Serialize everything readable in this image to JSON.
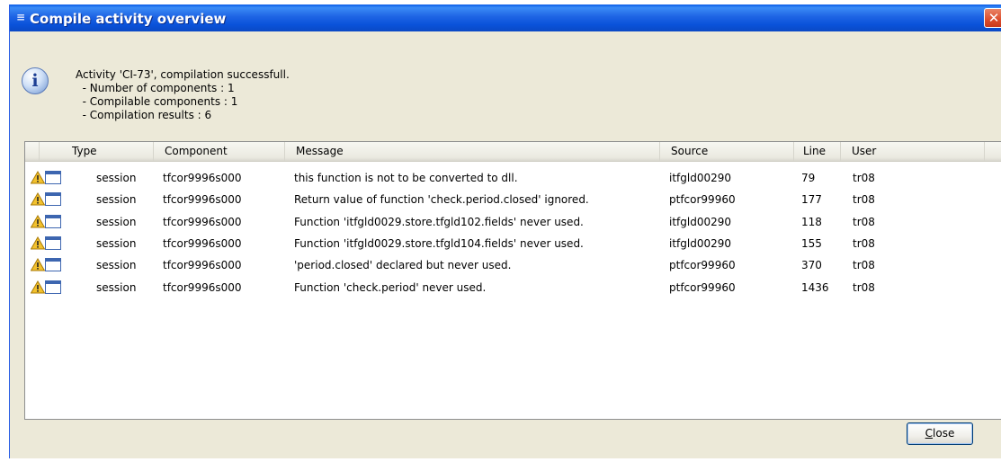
{
  "window": {
    "title": "Compile activity overview",
    "close_glyph": "✕"
  },
  "info": {
    "icon": "info-icon",
    "icon_glyph": "i",
    "lines": [
      "Activity 'CI-73', compilation successfull.",
      "  - Number of components : 1",
      "  - Compilable components : 1",
      "  - Compilation results : 6"
    ]
  },
  "table": {
    "columns": [
      "Type",
      "Component",
      "Message",
      "Source",
      "Line",
      "User"
    ],
    "rows": [
      {
        "type": "session",
        "component": "tfcor9996s000",
        "message": "this function is not to be converted to dll.",
        "source": "itfgld00290",
        "line": "79",
        "user": "tr08"
      },
      {
        "type": "session",
        "component": "tfcor9996s000",
        "message": "Return value of function 'check.period.closed' ignored.",
        "source": "ptfcor99960",
        "line": "177",
        "user": "tr08"
      },
      {
        "type": "session",
        "component": "tfcor9996s000",
        "message": "Function 'itfgld0029.store.tfgld102.fields' never used.",
        "source": "itfgld00290",
        "line": "118",
        "user": "tr08"
      },
      {
        "type": "session",
        "component": "tfcor9996s000",
        "message": "Function 'itfgld0029.store.tfgld104.fields' never used.",
        "source": "itfgld00290",
        "line": "155",
        "user": "tr08"
      },
      {
        "type": "session",
        "component": "tfcor9996s000",
        "message": "'period.closed' declared but never used.",
        "source": "ptfcor99960",
        "line": "370",
        "user": "tr08"
      },
      {
        "type": "session",
        "component": "tfcor9996s000",
        "message": "Function 'check.period' never used.",
        "source": "ptfcor99960",
        "line": "1436",
        "user": "tr08"
      }
    ],
    "row_icons": [
      "warning-icon",
      "window-icon"
    ]
  },
  "buttons": {
    "close_mnemonic": "C",
    "close_rest": "lose"
  },
  "colors": {
    "titlebar": "#0a52da",
    "dialog_bg": "#ece9d8",
    "warning": "#f2c12e"
  }
}
